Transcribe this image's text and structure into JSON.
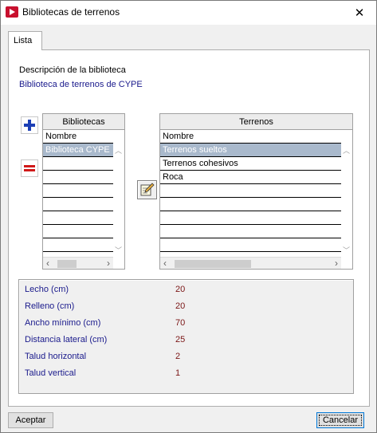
{
  "window": {
    "title": "Bibliotecas de terrenos",
    "close_glyph": "✕"
  },
  "tabs": [
    {
      "label": "Lista",
      "active": true
    }
  ],
  "description": {
    "label": "Descripción de la biblioteca",
    "value": "Biblioteca de terrenos de CYPE"
  },
  "libraries": {
    "title": "Bibliotecas",
    "column": "Nombre",
    "rows": [
      "Biblioteca CYPE",
      "",
      "",
      "",
      "",
      "",
      "",
      ""
    ],
    "selected_index": 0
  },
  "terrains": {
    "title": "Terrenos",
    "column": "Nombre",
    "rows": [
      "Terrenos sueltos",
      "Terrenos cohesivos",
      "Roca",
      "",
      "",
      "",
      "",
      ""
    ],
    "selected_index": 0
  },
  "toolbar": {
    "add_icon": "plus-icon",
    "remove_icon": "minus-icon",
    "edit_icon": "edit-icon"
  },
  "properties": [
    {
      "label": "Lecho (cm)",
      "value": "20"
    },
    {
      "label": "Relleno (cm)",
      "value": "20"
    },
    {
      "label": "Ancho mínimo (cm)",
      "value": "70"
    },
    {
      "label": "Distancia lateral (cm)",
      "value": "25"
    },
    {
      "label": "Talud horizontal",
      "value": "2"
    },
    {
      "label": "Talud vertical",
      "value": "1"
    }
  ],
  "buttons": {
    "accept": "Aceptar",
    "cancel": "Cancelar"
  },
  "scroll": {
    "left_glyph": "‹",
    "right_glyph": "›",
    "up_glyph": "︿",
    "down_glyph": "﹀"
  },
  "colors": {
    "label_blue": "#1a1a8c",
    "value_red": "#7a1515",
    "selection": "#a9b9cc"
  }
}
